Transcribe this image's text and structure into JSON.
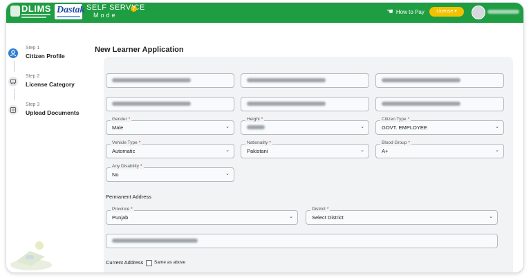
{
  "header": {
    "logo": "DLIMS",
    "brand": "Dastak",
    "app_title": "SELF SERVICE",
    "mode_label": "Mode",
    "help_icon": "?",
    "how_to_pay": "How to Pay",
    "license_menu": "License ▾",
    "colors": {
      "bar": "#1f9d43",
      "license_button": "#f2c100"
    }
  },
  "steps": [
    {
      "number": "Step 1",
      "title": "Citizen Profile",
      "icon": "user-icon",
      "active": true
    },
    {
      "number": "Step 2",
      "title": "License Category",
      "icon": "car-icon",
      "active": false
    },
    {
      "number": "Step 3",
      "title": "Upload Documents",
      "icon": "document-icon",
      "active": false
    }
  ],
  "page": {
    "title": "New Learner Application"
  },
  "form": {
    "gender": {
      "label": "Gender",
      "value": "Male"
    },
    "height": {
      "label": "Height",
      "value": ""
    },
    "citizen_type": {
      "label": "Citizen Type",
      "value": "GOVT. EMPLOYEE"
    },
    "vehicle_type": {
      "label": "Vehicle Type",
      "value": "Automatic"
    },
    "nationality": {
      "label": "Nationality",
      "value": "Pakistani"
    },
    "blood_group": {
      "label": "Blood Group",
      "value": "A+"
    },
    "disability": {
      "label": "Any Disability",
      "value": "No"
    },
    "permanent_address_label": "Permanent Address",
    "province": {
      "label": "Province",
      "value": "Punjab"
    },
    "district": {
      "label": "District",
      "value": "Select District"
    },
    "current_address_label": "Current Address",
    "same_as_above": "Same as above"
  }
}
